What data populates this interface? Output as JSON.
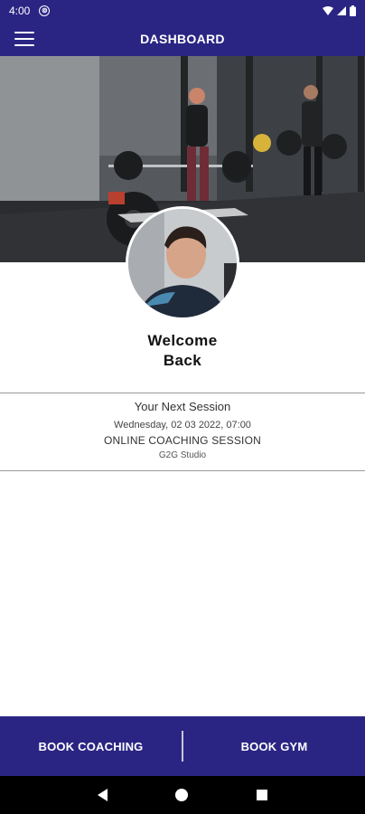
{
  "status_bar": {
    "time": "4:00",
    "badge": "⊚"
  },
  "app_bar": {
    "title": "DASHBOARD"
  },
  "profile": {
    "welcome_line1": "Welcome",
    "welcome_line2": "Back"
  },
  "next_session": {
    "heading": "Your Next Session",
    "datetime": "Wednesday, 02 03 2022, 07:00",
    "name": "ONLINE COACHING SESSION",
    "location": "G2G Studio"
  },
  "bottom_actions": {
    "book_coaching": "BOOK COACHING",
    "book_gym": "BOOK GYM"
  },
  "colors": {
    "brand": "#2a2583",
    "divider": "#9a9a9a"
  }
}
